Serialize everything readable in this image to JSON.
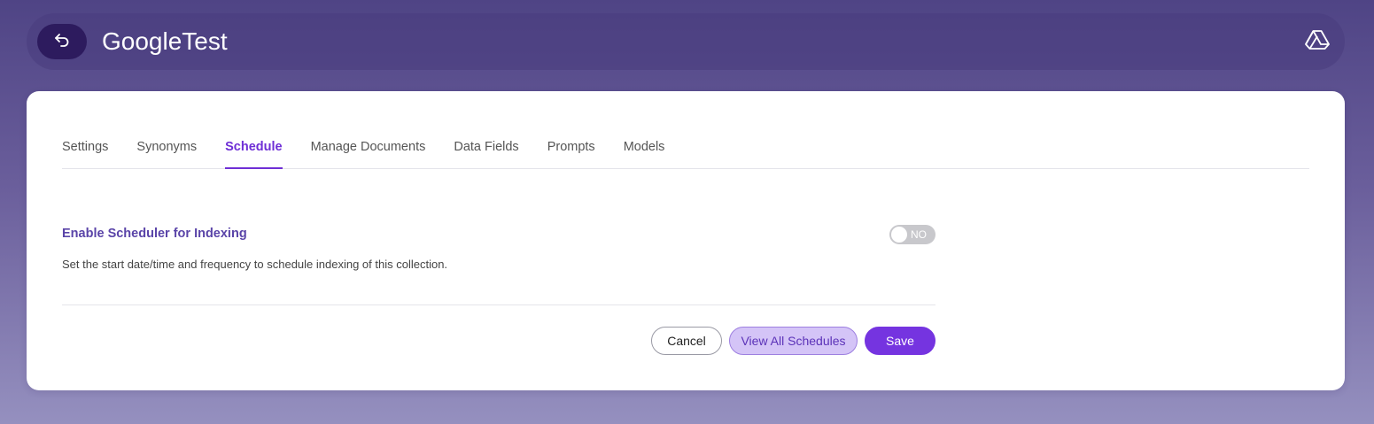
{
  "header": {
    "title": "GoogleTest",
    "back_icon": "back-arrow-icon",
    "source_icon": "google-drive-icon"
  },
  "tabs": [
    {
      "label": "Settings",
      "active": false
    },
    {
      "label": "Synonyms",
      "active": false
    },
    {
      "label": "Schedule",
      "active": true
    },
    {
      "label": "Manage Documents",
      "active": false
    },
    {
      "label": "Data Fields",
      "active": false
    },
    {
      "label": "Prompts",
      "active": false
    },
    {
      "label": "Models",
      "active": false
    }
  ],
  "schedule": {
    "title": "Enable Scheduler for Indexing",
    "description": "Set the start date/time and frequency to schedule indexing of this collection.",
    "toggle_label": "NO",
    "enabled": false
  },
  "actions": {
    "cancel": "Cancel",
    "view_all": "View All Schedules",
    "save": "Save"
  },
  "colors": {
    "accent": "#7534e0",
    "active_tab": "#6f2fd6",
    "section_title": "#5a44a8",
    "back_button": "#2d1b5e"
  }
}
